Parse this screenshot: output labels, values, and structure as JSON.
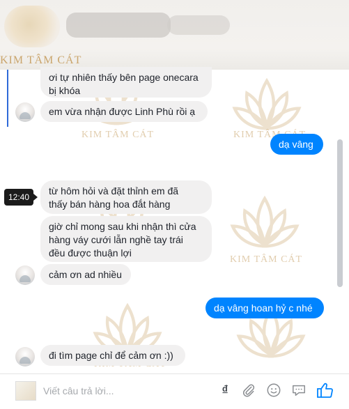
{
  "brand": {
    "name": "KIM TÂM CÁT"
  },
  "watermark": {
    "text": "KIM TÂM CÁT"
  },
  "messages": [
    {
      "side": "in",
      "lines": [
        "ơi tự nhiên thấy bên page onecara",
        "bị khóa"
      ]
    },
    {
      "side": "in",
      "lines": [
        "em vừa nhận được Linh Phù rồi ạ"
      ]
    },
    {
      "side": "out",
      "lines": [
        "dạ vâng"
      ]
    },
    {
      "side": "in",
      "lines": [
        "từ hôm hỏi và đặt thỉnh em đã",
        "thấy bán hàng hoa đắt hàng"
      ]
    },
    {
      "side": "in",
      "lines": [
        "giờ chỉ mong sau khi nhận thì cửa",
        "hàng váy cưới lẫn nghề tay trái",
        "đều được thuận lợi"
      ]
    },
    {
      "side": "in",
      "lines": [
        "cảm ơn ad nhiều"
      ]
    },
    {
      "side": "out",
      "lines": [
        "dạ vâng hoan hỷ c nhé"
      ]
    },
    {
      "side": "in",
      "lines": [
        "đi tìm page chỉ để cảm ơn :))"
      ]
    }
  ],
  "timestamp": "12:40",
  "composer": {
    "placeholder": "Viết câu trả lời...",
    "dong_label": "₫",
    "tools": [
      "dong-icon",
      "paperclip-icon",
      "emoji-icon",
      "chat-icon",
      "like-icon"
    ]
  },
  "colors": {
    "accent": "#0084ff",
    "incoming_bubble": "#f1f0f0",
    "brand_gold": "#caa56c"
  }
}
